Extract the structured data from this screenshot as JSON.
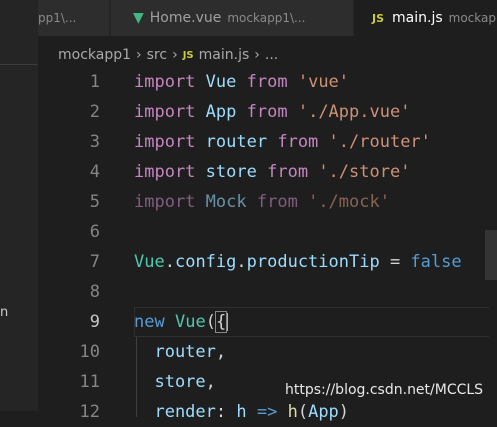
{
  "tabs": [
    {
      "label": "",
      "description": "pp1\\...",
      "icon": "file-icon"
    },
    {
      "label": "Home.vue",
      "description": "mockapp1\\...",
      "icon": "vue-icon"
    },
    {
      "label": "main.js",
      "description": "mockap",
      "icon": "js-icon",
      "active": true
    }
  ],
  "breadcrumb": {
    "folder1": "mockapp1",
    "folder2": "src",
    "file": "main.js",
    "more": "..."
  },
  "sidebar": {
    "fragment": "n"
  },
  "code": {
    "lines": [
      {
        "n": "1",
        "tokens": [
          {
            "t": "import",
            "c": "kw"
          },
          {
            "t": " ",
            "c": "op"
          },
          {
            "t": "Vue",
            "c": "var"
          },
          {
            "t": " ",
            "c": "op"
          },
          {
            "t": "from",
            "c": "kw"
          },
          {
            "t": " ",
            "c": "op"
          },
          {
            "t": "'vue'",
            "c": "str"
          }
        ]
      },
      {
        "n": "2",
        "tokens": [
          {
            "t": "import",
            "c": "kw"
          },
          {
            "t": " ",
            "c": "op"
          },
          {
            "t": "App",
            "c": "var"
          },
          {
            "t": " ",
            "c": "op"
          },
          {
            "t": "from",
            "c": "kw"
          },
          {
            "t": " ",
            "c": "op"
          },
          {
            "t": "'./App.vue'",
            "c": "str"
          }
        ]
      },
      {
        "n": "3",
        "tokens": [
          {
            "t": "import",
            "c": "kw"
          },
          {
            "t": " ",
            "c": "op"
          },
          {
            "t": "router",
            "c": "var"
          },
          {
            "t": " ",
            "c": "op"
          },
          {
            "t": "from",
            "c": "kw"
          },
          {
            "t": " ",
            "c": "op"
          },
          {
            "t": "'./router'",
            "c": "str"
          }
        ]
      },
      {
        "n": "4",
        "tokens": [
          {
            "t": "import",
            "c": "kw"
          },
          {
            "t": " ",
            "c": "op"
          },
          {
            "t": "store",
            "c": "var"
          },
          {
            "t": " ",
            "c": "op"
          },
          {
            "t": "from",
            "c": "kw"
          },
          {
            "t": " ",
            "c": "op"
          },
          {
            "t": "'./store'",
            "c": "str"
          }
        ]
      },
      {
        "n": "5",
        "faded": true,
        "tokens": [
          {
            "t": "import",
            "c": "kw"
          },
          {
            "t": " ",
            "c": "op"
          },
          {
            "t": "Mock",
            "c": "var"
          },
          {
            "t": " ",
            "c": "op"
          },
          {
            "t": "from",
            "c": "kw"
          },
          {
            "t": " ",
            "c": "op"
          },
          {
            "t": "'./mock'",
            "c": "str"
          }
        ]
      },
      {
        "n": "6",
        "tokens": []
      },
      {
        "n": "7",
        "tokens": [
          {
            "t": "Vue",
            "c": "cls"
          },
          {
            "t": ".",
            "c": "op"
          },
          {
            "t": "config",
            "c": "var"
          },
          {
            "t": ".",
            "c": "op"
          },
          {
            "t": "productionTip",
            "c": "var"
          },
          {
            "t": " = ",
            "c": "op"
          },
          {
            "t": "false",
            "c": "bool"
          }
        ]
      },
      {
        "n": "8",
        "tokens": []
      },
      {
        "n": "9",
        "active": true,
        "tokens": [
          {
            "t": "new",
            "c": "bool"
          },
          {
            "t": " ",
            "c": "op"
          },
          {
            "t": "Vue",
            "c": "cls"
          },
          {
            "t": "(",
            "c": "op"
          },
          {
            "t": "{",
            "c": "op",
            "hl": true
          }
        ]
      },
      {
        "n": "10",
        "tokens": [
          {
            "t": "  router",
            "c": "var"
          },
          {
            "t": ",",
            "c": "op"
          }
        ]
      },
      {
        "n": "11",
        "tokens": [
          {
            "t": "  store",
            "c": "var"
          },
          {
            "t": ",",
            "c": "op"
          }
        ]
      },
      {
        "n": "12",
        "tokens": [
          {
            "t": "  render",
            "c": "var"
          },
          {
            "t": ": ",
            "c": "op"
          },
          {
            "t": "h",
            "c": "var"
          },
          {
            "t": " => ",
            "c": "bool"
          },
          {
            "t": "h",
            "c": "fn"
          },
          {
            "t": "(",
            "c": "op"
          },
          {
            "t": "App",
            "c": "var"
          },
          {
            "t": ")",
            "c": "op"
          }
        ]
      }
    ]
  },
  "watermark": "https://blog.csdn.net/MCCLS",
  "colors": {
    "background": "#1e1e1e",
    "keyword": "#c586c0",
    "variable": "#9cdcfe",
    "string": "#ce9178"
  }
}
